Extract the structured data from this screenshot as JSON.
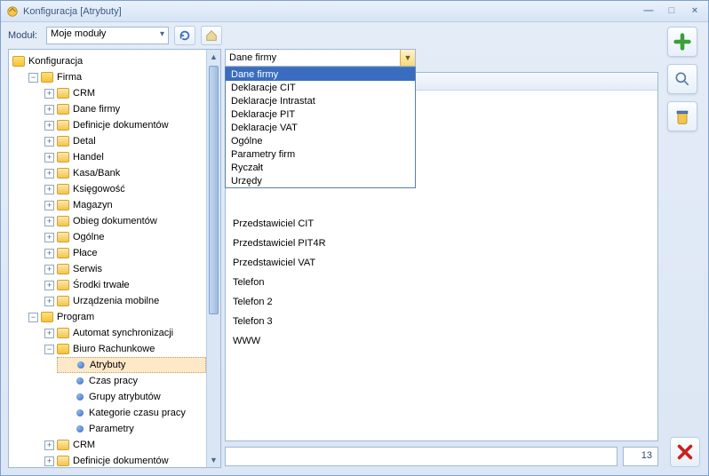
{
  "window": {
    "title": "Konfiguracja [Atrybuty]"
  },
  "toolbar": {
    "module_label": "Moduł:",
    "module_value": "Moje moduły"
  },
  "tree": {
    "root": "Konfiguracja",
    "firma": "Firma",
    "firma_children": [
      "CRM",
      "Dane firmy",
      "Definicje dokumentów",
      "Detal",
      "Handel",
      "Kasa/Bank",
      "Księgowość",
      "Magazyn",
      "Obieg dokumentów",
      "Ogólne",
      "Płace",
      "Serwis",
      "Środki trwałe",
      "Urządzenia mobilne"
    ],
    "program": "Program",
    "program_children": [
      "Automat synchronizacji"
    ],
    "biuro": "Biuro Rachunkowe",
    "biuro_children": [
      "Atrybuty",
      "Czas pracy",
      "Grupy atrybutów",
      "Kategorie czasu pracy",
      "Parametry"
    ],
    "program_after": [
      "CRM",
      "Definicje dokumentów"
    ]
  },
  "combo": {
    "value": "Dane firmy",
    "options": [
      "Dane firmy",
      "Deklaracje CIT",
      "Deklaracje Intrastat",
      "Deklaracje PIT",
      "Deklaracje VAT",
      "Ogólne",
      "Parametry firm",
      "Ryczałt",
      "Urzędy"
    ]
  },
  "list_items": [
    "Przedstawiciel CIT",
    "Przedstawiciel PIT4R",
    "Przedstawiciel VAT",
    "Telefon",
    "Telefon 2",
    "Telefon 3",
    "WWW"
  ],
  "counter": "13"
}
